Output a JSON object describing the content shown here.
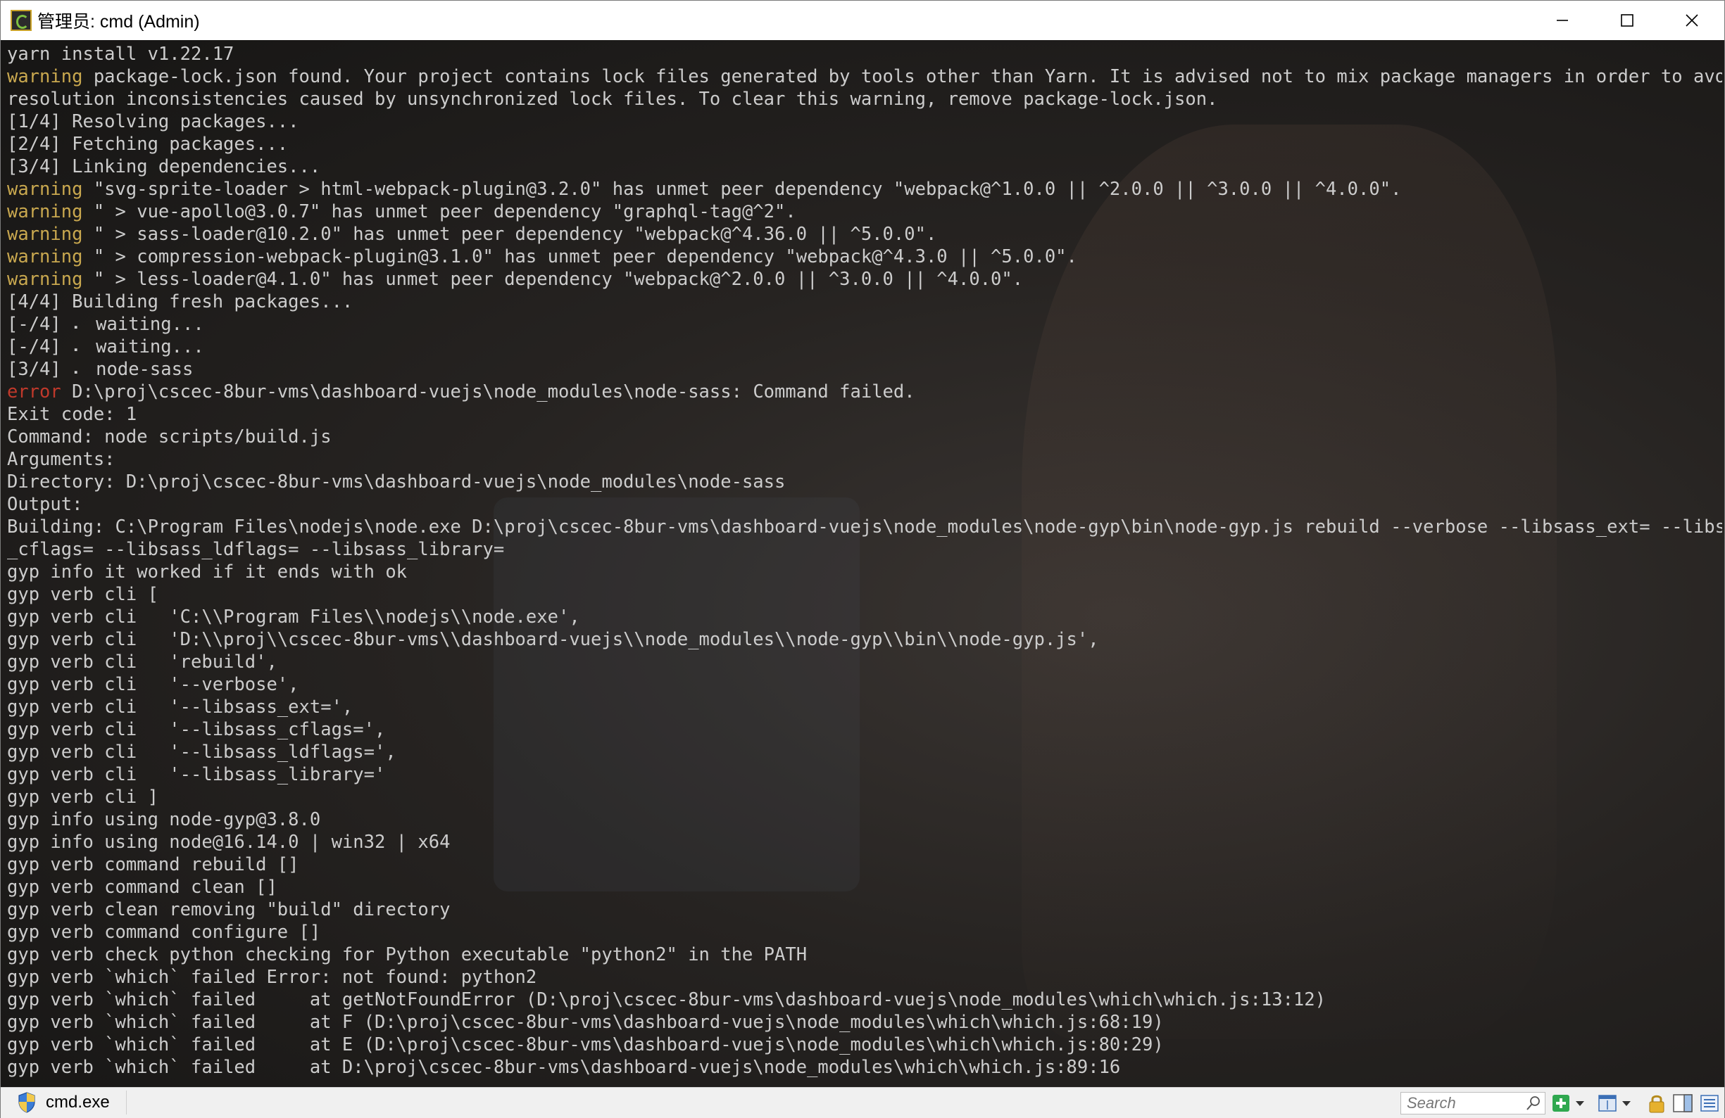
{
  "window": {
    "title": "管理员: cmd (Admin)"
  },
  "console": {
    "lines": [
      [
        {
          "t": "yarn install v1.22.17"
        }
      ],
      [
        {
          "t": "warning",
          "c": "warning"
        },
        {
          "t": " package-lock.json found. Your project contains lock files generated by tools other than Yarn. It is advised not to mix package managers in order to avoid"
        }
      ],
      [
        {
          "t": "resolution inconsistencies caused by unsynchronized lock files. To clear this warning, remove package-lock.json."
        }
      ],
      [
        {
          "t": "[1/4] Resolving packages..."
        }
      ],
      [
        {
          "t": "[2/4] Fetching packages..."
        }
      ],
      [
        {
          "t": "[3/4] Linking dependencies..."
        }
      ],
      [
        {
          "t": "warning",
          "c": "warning"
        },
        {
          "t": " \"svg-sprite-loader > html-webpack-plugin@3.2.0\" has unmet peer dependency \"webpack@^1.0.0 || ^2.0.0 || ^3.0.0 || ^4.0.0\"."
        }
      ],
      [
        {
          "t": "warning",
          "c": "warning"
        },
        {
          "t": " \" > vue-apollo@3.0.7\" has unmet peer dependency \"graphql-tag@^2\"."
        }
      ],
      [
        {
          "t": "warning",
          "c": "warning"
        },
        {
          "t": " \" > sass-loader@10.2.0\" has unmet peer dependency \"webpack@^4.36.0 || ^5.0.0\"."
        }
      ],
      [
        {
          "t": "warning",
          "c": "warning"
        },
        {
          "t": " \" > compression-webpack-plugin@3.1.0\" has unmet peer dependency \"webpack@^4.3.0 || ^5.0.0\"."
        }
      ],
      [
        {
          "t": "warning",
          "c": "warning"
        },
        {
          "t": " \" > less-loader@4.1.0\" has unmet peer dependency \"webpack@^2.0.0 || ^3.0.0 || ^4.0.0\"."
        }
      ],
      [
        {
          "t": "[4/4] Building fresh packages..."
        }
      ],
      [
        {
          "t": "[-/4] ⠄ waiting..."
        }
      ],
      [
        {
          "t": "[-/4] ⠄ waiting..."
        }
      ],
      [
        {
          "t": "[3/4] ⠄ node-sass"
        }
      ],
      [
        {
          "t": "error",
          "c": "error"
        },
        {
          "t": " D:\\proj\\cscec-8bur-vms\\dashboard-vuejs\\node_modules\\node-sass: Command failed."
        }
      ],
      [
        {
          "t": "Exit code: 1"
        }
      ],
      [
        {
          "t": "Command: node scripts/build.js"
        }
      ],
      [
        {
          "t": "Arguments:"
        }
      ],
      [
        {
          "t": "Directory: D:\\proj\\cscec-8bur-vms\\dashboard-vuejs\\node_modules\\node-sass"
        }
      ],
      [
        {
          "t": "Output:"
        }
      ],
      [
        {
          "t": "Building: C:\\Program Files\\nodejs\\node.exe D:\\proj\\cscec-8bur-vms\\dashboard-vuejs\\node_modules\\node-gyp\\bin\\node-gyp.js rebuild --verbose --libsass_ext= --libsass"
        }
      ],
      [
        {
          "t": "_cflags= --libsass_ldflags= --libsass_library="
        }
      ],
      [
        {
          "t": "gyp info it worked if it ends with ok"
        }
      ],
      [
        {
          "t": "gyp verb cli ["
        }
      ],
      [
        {
          "t": "gyp verb cli   'C:\\\\Program Files\\\\nodejs\\\\node.exe',"
        }
      ],
      [
        {
          "t": "gyp verb cli   'D:\\\\proj\\\\cscec-8bur-vms\\\\dashboard-vuejs\\\\node_modules\\\\node-gyp\\\\bin\\\\node-gyp.js',"
        }
      ],
      [
        {
          "t": "gyp verb cli   'rebuild',"
        }
      ],
      [
        {
          "t": "gyp verb cli   '--verbose',"
        }
      ],
      [
        {
          "t": "gyp verb cli   '--libsass_ext=',"
        }
      ],
      [
        {
          "t": "gyp verb cli   '--libsass_cflags=',"
        }
      ],
      [
        {
          "t": "gyp verb cli   '--libsass_ldflags=',"
        }
      ],
      [
        {
          "t": "gyp verb cli   '--libsass_library='"
        }
      ],
      [
        {
          "t": "gyp verb cli ]"
        }
      ],
      [
        {
          "t": "gyp info using node-gyp@3.8.0"
        }
      ],
      [
        {
          "t": "gyp info using node@16.14.0 | win32 | x64"
        }
      ],
      [
        {
          "t": "gyp verb command rebuild []"
        }
      ],
      [
        {
          "t": "gyp verb command clean []"
        }
      ],
      [
        {
          "t": "gyp verb clean removing \"build\" directory"
        }
      ],
      [
        {
          "t": "gyp verb command configure []"
        }
      ],
      [
        {
          "t": "gyp verb check python checking for Python executable \"python2\" in the PATH"
        }
      ],
      [
        {
          "t": "gyp verb `which` failed Error: not found: python2"
        }
      ],
      [
        {
          "t": "gyp verb `which` failed     at getNotFoundError (D:\\proj\\cscec-8bur-vms\\dashboard-vuejs\\node_modules\\which\\which.js:13:12)"
        }
      ],
      [
        {
          "t": "gyp verb `which` failed     at F (D:\\proj\\cscec-8bur-vms\\dashboard-vuejs\\node_modules\\which\\which.js:68:19)"
        }
      ],
      [
        {
          "t": "gyp verb `which` failed     at E (D:\\proj\\cscec-8bur-vms\\dashboard-vuejs\\node_modules\\which\\which.js:80:29)"
        }
      ],
      [
        {
          "t": "gyp verb `which` failed     at D:\\proj\\cscec-8bur-vms\\dashboard-vuejs\\node_modules\\which\\which.js:89:16"
        }
      ]
    ]
  },
  "statusbar": {
    "process": "cmd.exe",
    "search_placeholder": "Search"
  },
  "icons": {
    "app": "console-icon",
    "minimize": "minimize-icon",
    "maximize": "maximize-icon",
    "close": "close-icon",
    "shield": "admin-shield-icon",
    "search": "search-icon",
    "new_console": "add-console-icon",
    "layout": "layout-icon",
    "lock": "lock-icon",
    "split": "split-view-icon",
    "menu": "menu-icon"
  },
  "colors": {
    "warning": "#c9a84f",
    "error": "#c0392b",
    "text": "#cccccc",
    "background": "#262321"
  }
}
